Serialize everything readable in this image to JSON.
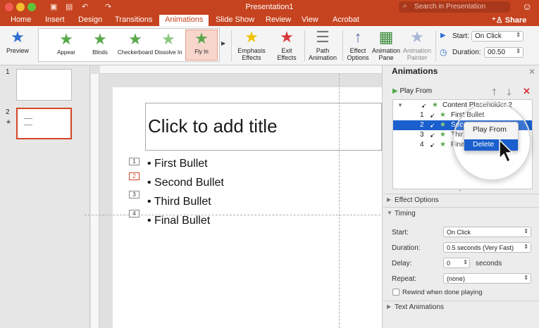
{
  "window": {
    "title": "Presentation1",
    "search_placeholder": "Search in Presentation",
    "share_label": "Share"
  },
  "tabs": [
    "Home",
    "Insert",
    "Design",
    "Transitions",
    "Animations",
    "Slide Show",
    "Review",
    "View",
    "Acrobat"
  ],
  "active_tab": "Animations",
  "ribbon": {
    "preview_label": "Preview",
    "gallery": [
      "Appear",
      "Blinds",
      "Checkerboard",
      "Dissolve In",
      "Fly In"
    ],
    "gallery_selected": "Fly In",
    "emphasis_label": "Emphasis Effects",
    "exit_label": "Exit Effects",
    "path_label": "Path Animation",
    "effect_options_label": "Effect Options",
    "animation_pane_label": "Animation Pane",
    "animation_painter_label": "Animation Painter",
    "start_label": "Start:",
    "start_value": "On Click",
    "duration_label": "Duration:",
    "duration_value": "00.50"
  },
  "slides": {
    "numbers": [
      "1",
      "2"
    ],
    "selected": "2"
  },
  "slide": {
    "title_placeholder": "Click to add title",
    "bullets": [
      "First Bullet",
      "Second Bullet",
      "Third Bullet",
      "Final Bullet"
    ],
    "tags": [
      "1",
      "2",
      "3",
      "4"
    ]
  },
  "pane": {
    "title": "Animations",
    "play_from": "Play From",
    "group_name": "Content Placeholder 2",
    "items": [
      {
        "num": "1",
        "name": "First Bullet"
      },
      {
        "num": "2",
        "name": "Sec"
      },
      {
        "num": "3",
        "name": "Thir"
      },
      {
        "num": "4",
        "name": "Fina"
      }
    ],
    "selected_num": "2",
    "context_menu": [
      "Play From",
      "Delete"
    ],
    "context_highlight": "Delete",
    "effect_options": "Effect Options",
    "timing": "Timing",
    "start_label": "Start:",
    "start_value": "On Click",
    "duration_label": "Duration:",
    "duration_value": "0.5 seconds (Very Fast)",
    "delay_label": "Delay:",
    "delay_value": "0",
    "delay_unit": "seconds",
    "repeat_label": "Repeat:",
    "repeat_value": "(none)",
    "rewind_label": "Rewind when done playing",
    "text_animations": "Text Animations"
  },
  "colors": {
    "accent": "#c6431f",
    "selection": "#1a5fcd",
    "star_green": "#59a84b",
    "star_yellow": "#f2c200",
    "star_red": "#d8373b"
  }
}
